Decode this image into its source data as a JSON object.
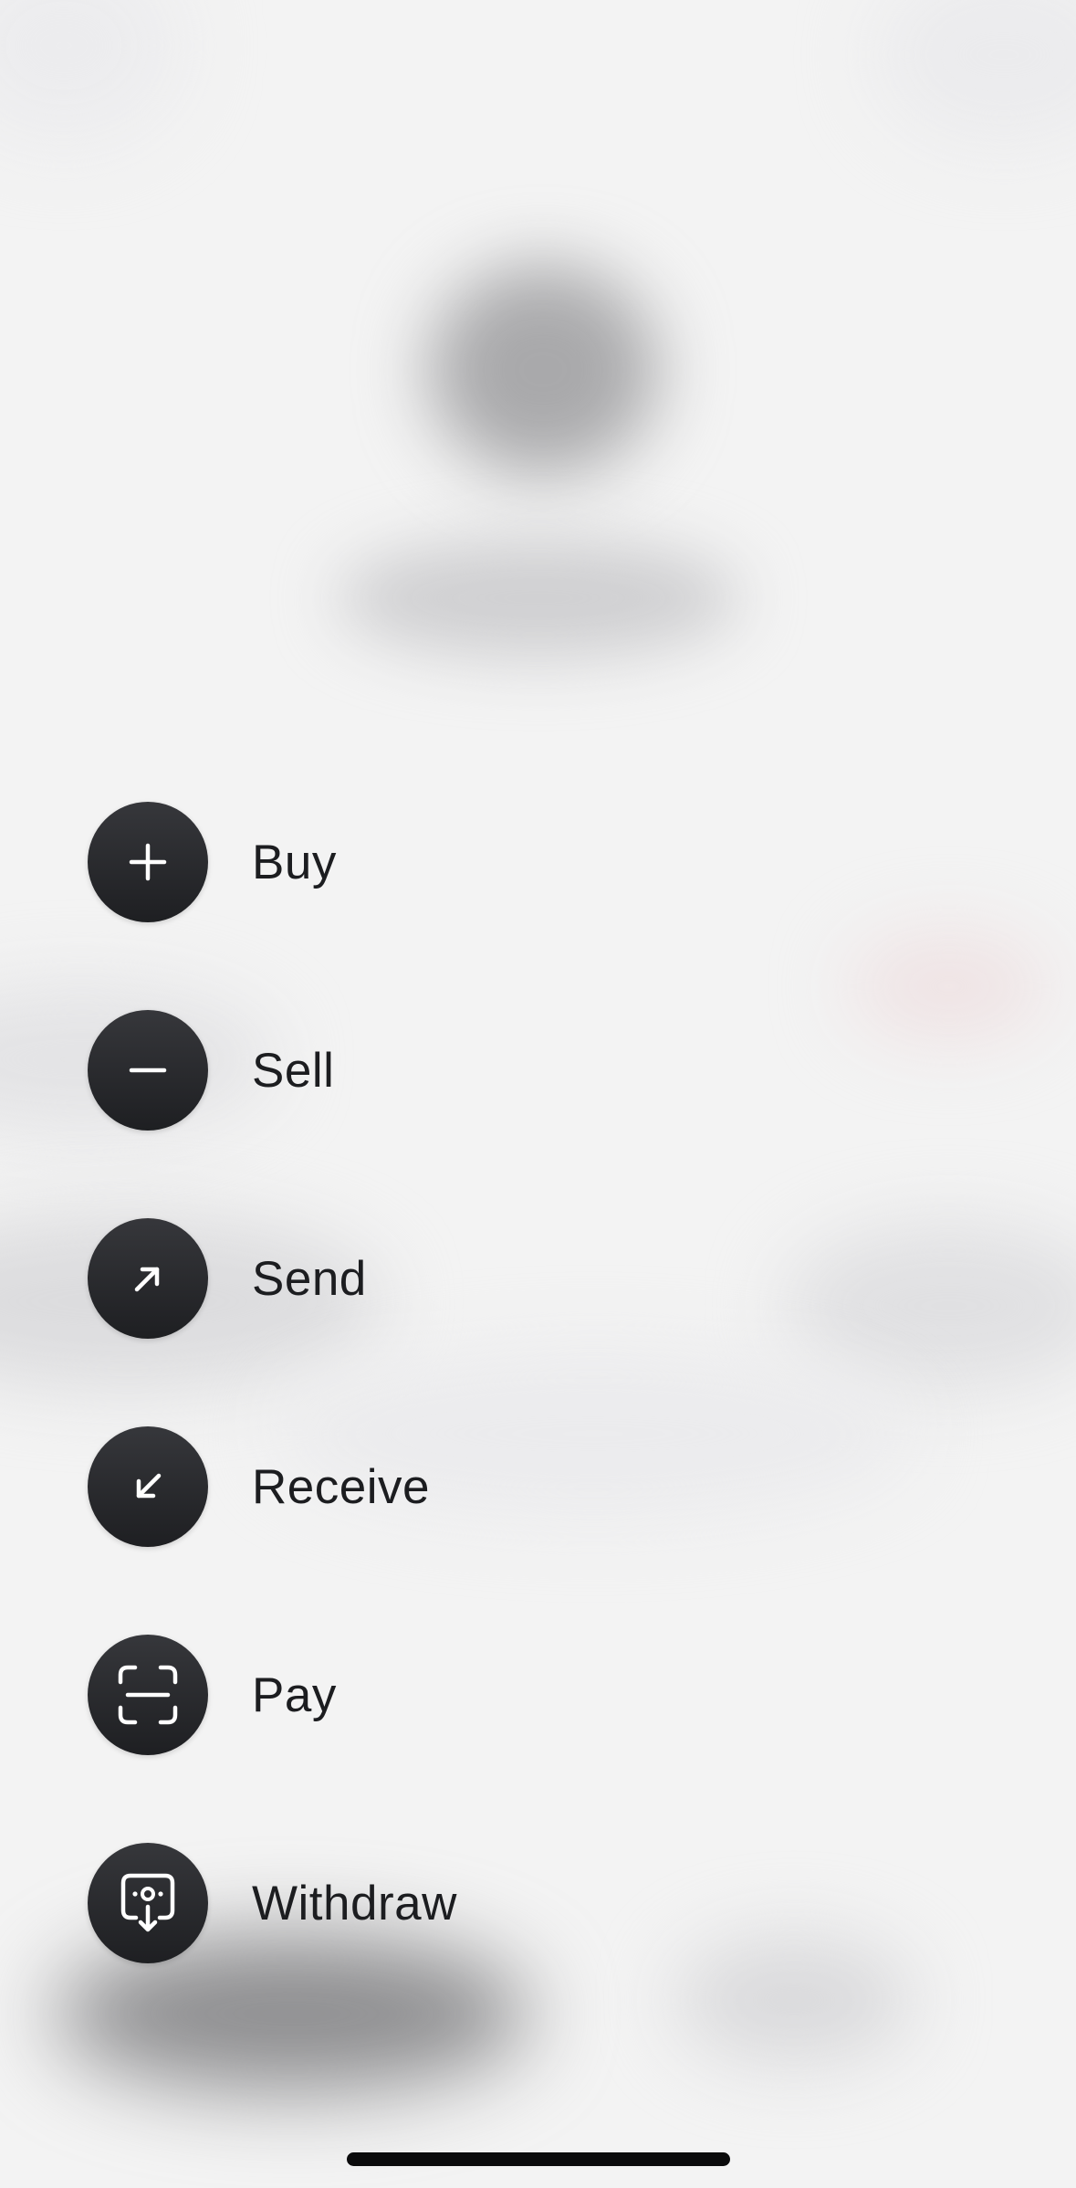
{
  "actions": [
    {
      "label": "Buy",
      "icon": "plus-icon"
    },
    {
      "label": "Sell",
      "icon": "minus-icon"
    },
    {
      "label": "Send",
      "icon": "arrow-up-right-icon"
    },
    {
      "label": "Receive",
      "icon": "arrow-down-left-icon"
    },
    {
      "label": "Pay",
      "icon": "scan-icon"
    },
    {
      "label": "Withdraw",
      "icon": "withdraw-icon"
    }
  ],
  "colors": {
    "background": "#f3f3f3",
    "button": "#2a2b2f",
    "icon": "#ffffff",
    "label": "#1c1d20",
    "home_indicator": "#0b0b0c"
  }
}
